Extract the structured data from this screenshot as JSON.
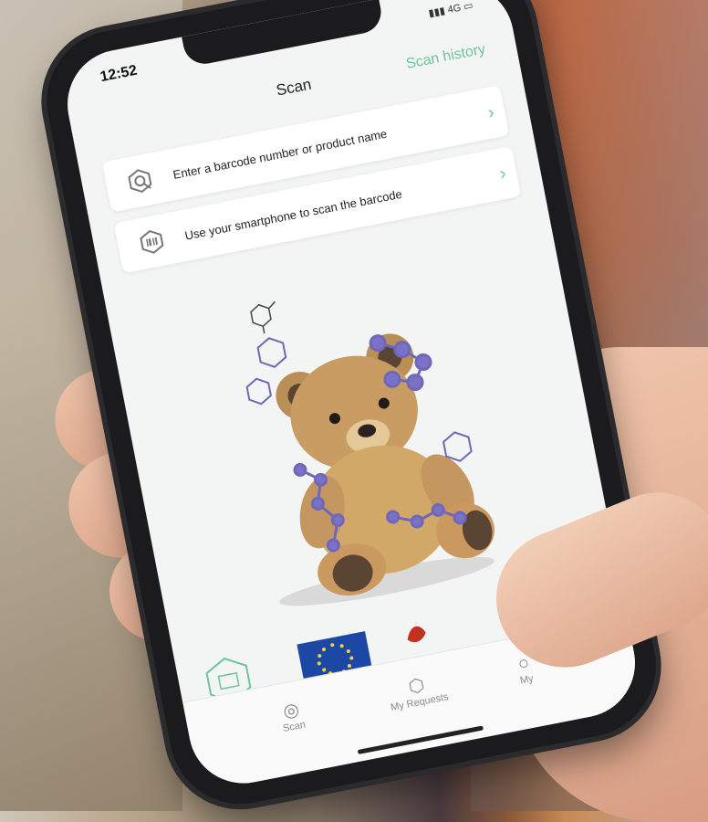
{
  "status_bar": {
    "time": "12:52",
    "network": "4G"
  },
  "nav": {
    "title": "Scan",
    "history_label": "Scan history"
  },
  "actions": [
    {
      "label": "Enter a barcode number or product name",
      "icon": "search-molecule-icon"
    },
    {
      "label": "Use your smartphone to scan the barcode",
      "icon": "barcode-scan-icon"
    }
  ],
  "tabs": [
    {
      "label": "Scan",
      "icon": "scan-icon"
    },
    {
      "label": "My Requests",
      "icon": "requests-icon"
    },
    {
      "label": "My",
      "icon": "profile-icon"
    }
  ],
  "colors": {
    "accent": "#6cc59a",
    "eu_blue": "#1d47a5",
    "eu_star": "#f2d23b"
  }
}
